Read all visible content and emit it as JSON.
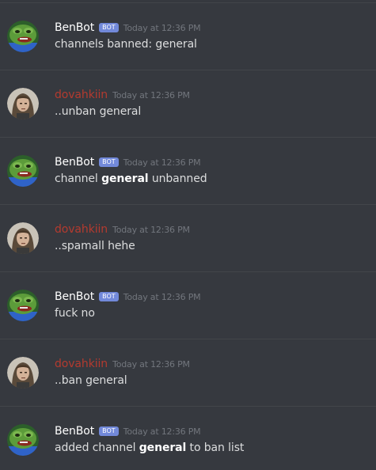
{
  "messages": [
    {
      "author": "BenBot",
      "author_type": "bot",
      "bot_tag": "BOT",
      "timestamp": "Today at 12:36 PM",
      "text": "channels banned: general",
      "pre": "",
      "bold": "",
      "post": ""
    },
    {
      "author": "dovahkiin",
      "author_type": "user",
      "timestamp": "Today at 12:36 PM",
      "text": "..unban general",
      "pre": "",
      "bold": "",
      "post": ""
    },
    {
      "author": "BenBot",
      "author_type": "bot",
      "bot_tag": "BOT",
      "timestamp": "Today at 12:36 PM",
      "text": "",
      "pre": "channel ",
      "bold": "general",
      "post": " unbanned"
    },
    {
      "author": "dovahkiin",
      "author_type": "user",
      "timestamp": "Today at 12:36 PM",
      "text": "..spamall hehe",
      "pre": "",
      "bold": "",
      "post": ""
    },
    {
      "author": "BenBot",
      "author_type": "bot",
      "bot_tag": "BOT",
      "timestamp": "Today at 12:36 PM",
      "text": "fuck no",
      "pre": "",
      "bold": "",
      "post": ""
    },
    {
      "author": "dovahkiin",
      "author_type": "user",
      "timestamp": "Today at 12:36 PM",
      "text": "..ban general",
      "pre": "",
      "bold": "",
      "post": ""
    },
    {
      "author": "BenBot",
      "author_type": "bot",
      "bot_tag": "BOT",
      "timestamp": "Today at 12:36 PM",
      "text": "",
      "pre": "added channel ",
      "bold": "general",
      "post": " to ban list"
    }
  ],
  "colors": {
    "background": "#36393f",
    "bot_name": "#ffffff",
    "user_name": "#b43a2f",
    "bot_tag": "#7289da",
    "message_text": "#dcddde",
    "timestamp": "#72767d"
  },
  "icons": {
    "bot_avatar": "pepe-frog-avatar-icon",
    "user_avatar": "long-hair-man-avatar-icon"
  }
}
